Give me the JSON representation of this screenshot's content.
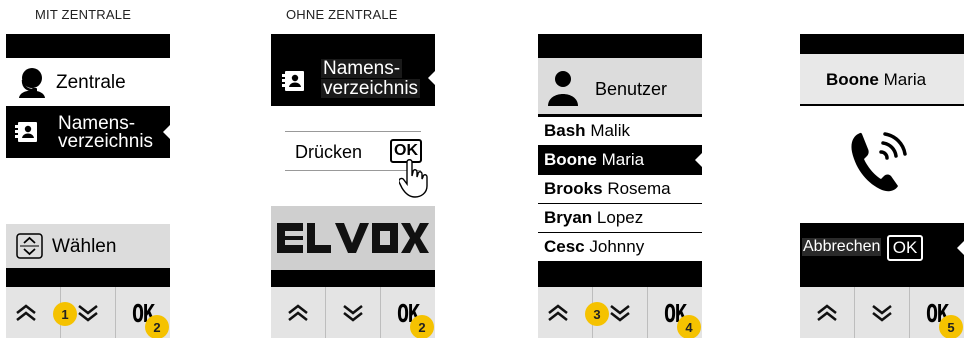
{
  "captions": {
    "with_central": "MIT ZENTRALE",
    "without_central": "OHNE ZENTRALE"
  },
  "keys": {
    "up_icon": "double-chevron-up-icon",
    "down_icon": "double-chevron-down-icon",
    "ok_label": "OK"
  },
  "screen1": {
    "item1_label": "Zentrale",
    "item2_line1": "Namens-",
    "item2_line2": "verzeichnis",
    "select_label": "Wählen",
    "badges": [
      "1",
      "2"
    ]
  },
  "screen2": {
    "title_line1": "Namens-",
    "title_line2": "verzeichnis",
    "press_label": "Drücken",
    "ok_box": "OK",
    "logo": "ELVOX",
    "badges": [
      "2"
    ]
  },
  "screen3": {
    "header": "Benutzer",
    "users": [
      {
        "last": "Bash",
        "first": "Malik",
        "selected": false
      },
      {
        "last": "Boone",
        "first": "Maria",
        "selected": true
      },
      {
        "last": "Brooks",
        "first": "Rosema",
        "selected": false
      },
      {
        "last": "Bryan",
        "first": "Lopez",
        "selected": false
      },
      {
        "last": "Cesc",
        "first": "Johnny",
        "selected": false
      }
    ],
    "badges": [
      "3",
      "4"
    ]
  },
  "screen4": {
    "name_last": "Boone",
    "name_first": "Maria",
    "cancel_label": "Abbrechen",
    "ok_box": "OK",
    "badges": [
      "5"
    ]
  },
  "colors": {
    "badge": "#f5c200",
    "screen_bg": "#000000",
    "keypad_bg": "#e4e4e4"
  }
}
